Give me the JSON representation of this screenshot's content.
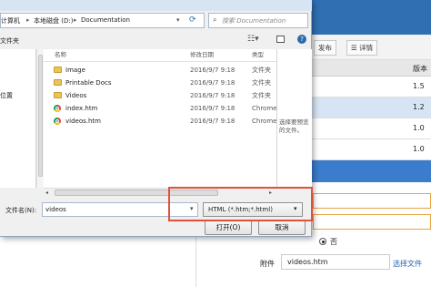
{
  "dialog": {
    "breadcrumb": [
      "计算机",
      "本地磁盘 (D:)",
      "Documentation"
    ],
    "search_placeholder": "搜索 Documentation",
    "toolbar": {
      "new_folder": "文件夹"
    },
    "nav": {
      "item": "位置"
    },
    "columns": {
      "name": "名称",
      "date": "修改日期",
      "type": "类型"
    },
    "files": [
      {
        "name": "Image",
        "date": "2016/9/7 9:18",
        "type": "文件夹",
        "icon": "folder-icon"
      },
      {
        "name": "Printable Docs",
        "date": "2016/9/7 9:18",
        "type": "文件夹",
        "icon": "folder-icon"
      },
      {
        "name": "Videos",
        "date": "2016/9/7 9:18",
        "type": "文件夹",
        "icon": "folder-icon"
      },
      {
        "name": "index.htm",
        "date": "2016/9/7 9:18",
        "type": "Chrome",
        "icon": "chrome-icon"
      },
      {
        "name": "videos.htm",
        "date": "2016/9/7 9:18",
        "type": "Chrome",
        "icon": "chrome-icon"
      }
    ],
    "preview_text": [
      "选择要预览",
      "的文件。"
    ],
    "filename_label": "文件名(N):",
    "filename_value": "videos",
    "filter_value": "HTML (*.htm;*.html)",
    "open_button": "打开(O)",
    "cancel_button": "取消"
  },
  "app": {
    "toolbar": {
      "publish": "发布",
      "details": "详情"
    },
    "grid": {
      "header": "版本",
      "versions": [
        "1.5",
        "1.2",
        "1.0",
        "1.0"
      ]
    },
    "radio_no": "否",
    "attachment_label": "附件",
    "attachment_value": "videos.htm",
    "choose_file": "选择文件"
  },
  "colors": {
    "highlight": "#e2503a",
    "accent": "#3b7ccc",
    "input_border": "#e8a340"
  }
}
